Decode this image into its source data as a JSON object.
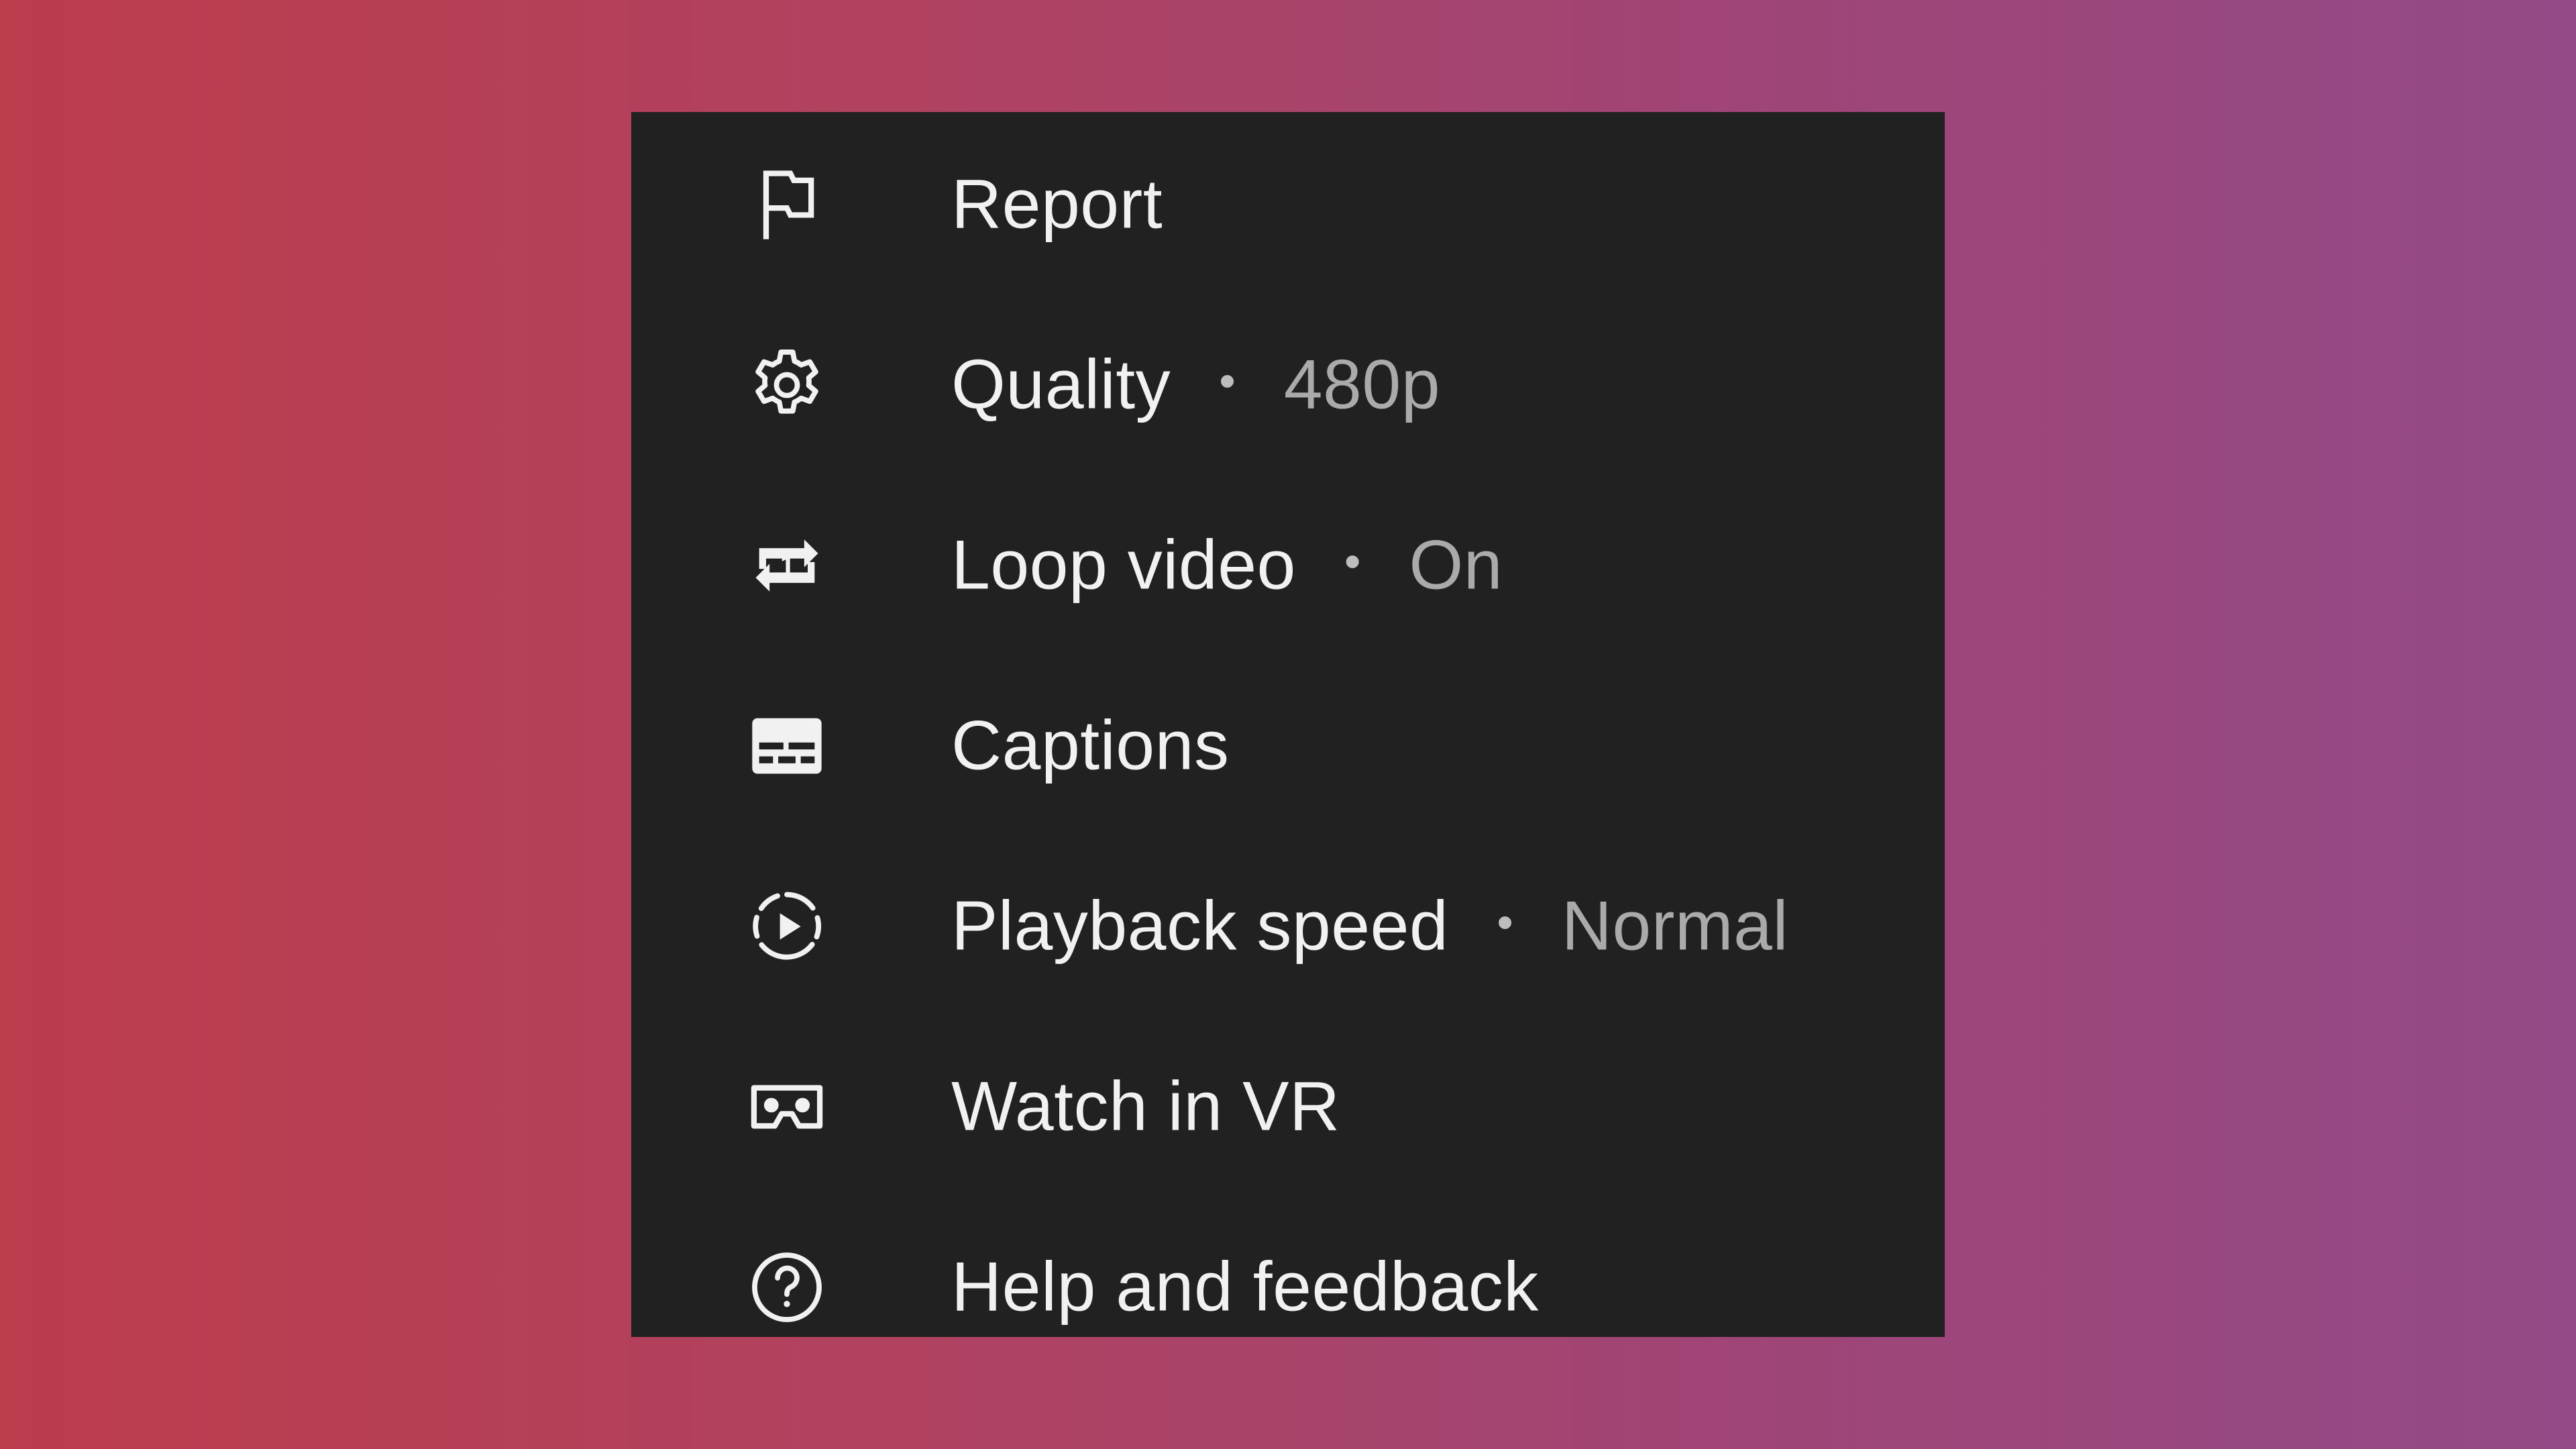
{
  "colors": {
    "menu_background": "#212121",
    "label_text": "#f1f1f1",
    "value_text": "#aaaaaa",
    "gradient_left": "#bb3c4b",
    "gradient_right": "#934a86"
  },
  "separator": "•",
  "menu": {
    "items": [
      {
        "label": "Report",
        "icon": "flag-icon"
      },
      {
        "label": "Quality",
        "value": "480p",
        "icon": "gear-icon"
      },
      {
        "label": "Loop video",
        "value": "On",
        "icon": "loop-one-icon"
      },
      {
        "label": "Captions",
        "icon": "closed-captions-icon"
      },
      {
        "label": "Playback speed",
        "value": "Normal",
        "icon": "playback-speed-icon"
      },
      {
        "label": "Watch in VR",
        "icon": "vr-headset-icon"
      },
      {
        "label": "Help and feedback",
        "icon": "help-circle-icon"
      }
    ]
  }
}
